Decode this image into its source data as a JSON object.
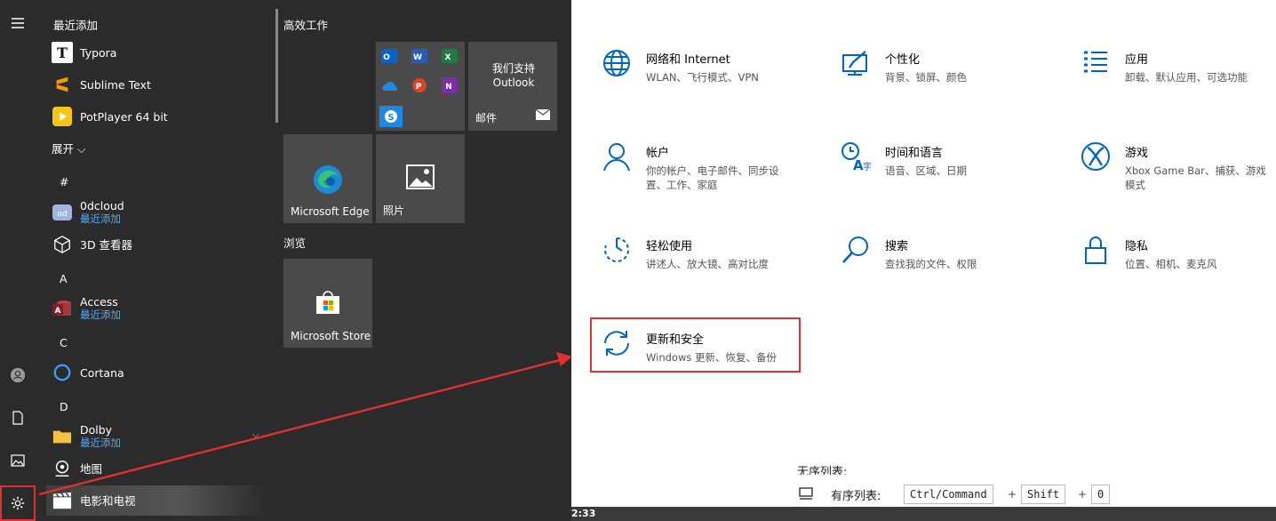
{
  "start_menu": {
    "recent_header": "最近添加",
    "expand_label": "展开",
    "apps": [
      {
        "name": "Typora",
        "sub": "",
        "icon": "typora-icon"
      },
      {
        "name": "Sublime Text",
        "sub": "",
        "icon": "sublime-icon"
      },
      {
        "name": "PotPlayer 64 bit",
        "sub": "",
        "icon": "potplayer-icon"
      },
      {
        "name": "0dcloud",
        "sub": "最近添加",
        "icon": "cloud-icon"
      },
      {
        "name": "3D 查看器",
        "sub": "",
        "icon": "3d-viewer-icon"
      },
      {
        "name": "Access",
        "sub": "最近添加",
        "icon": "access-icon"
      },
      {
        "name": "Cortana",
        "sub": "",
        "icon": "cortana-icon"
      },
      {
        "name": "Dolby",
        "sub": "最近添加",
        "icon": "folder-icon"
      },
      {
        "name": "地图",
        "sub": "",
        "icon": "maps-icon"
      },
      {
        "name": "电影和电视",
        "sub": "",
        "icon": "movies-icon"
      }
    ],
    "letters": [
      "#",
      "A",
      "C",
      "D"
    ],
    "tile_groups": {
      "productivity": "高效工作",
      "browse": "浏览"
    },
    "tiles": {
      "mail_promo": "我们支持 Outlook",
      "mail_label": "邮件",
      "edge_label": "Microsoft Edge",
      "photos_label": "照片",
      "store_label": "Microsoft Store"
    }
  },
  "settings": {
    "categories": [
      {
        "title": "网络和 Internet",
        "desc": "WLAN、飞行模式、VPN",
        "icon": "globe-icon"
      },
      {
        "title": "个性化",
        "desc": "背景、锁屏、颜色",
        "icon": "personalization-icon"
      },
      {
        "title": "应用",
        "desc": "卸载、默认应用、可选功能",
        "icon": "apps-icon"
      },
      {
        "title": "帐户",
        "desc": "你的帐户、电子邮件、同步设置、工作、家庭",
        "icon": "account-icon"
      },
      {
        "title": "时间和语言",
        "desc": "语音、区域、日期",
        "icon": "time-language-icon"
      },
      {
        "title": "游戏",
        "desc": "Xbox Game Bar、捕获、游戏模式",
        "icon": "xbox-icon"
      },
      {
        "title": "轻松使用",
        "desc": "讲述人、放大镜、高对比度",
        "icon": "ease-of-access-icon"
      },
      {
        "title": "搜索",
        "desc": "查找我的文件、权限",
        "icon": "search-icon"
      },
      {
        "title": "隐私",
        "desc": "位置、相机、麦克风",
        "icon": "lock-icon"
      },
      {
        "title": "更新和安全",
        "desc": "Windows 更新、恢复、备份",
        "icon": "update-icon"
      }
    ]
  },
  "behind_window": {
    "row_label": "有序列表:",
    "keys": [
      "Ctrl/Command",
      "Shift",
      "0"
    ],
    "partial_row_label": "无序列表:",
    "clock": "2:33"
  },
  "colors": {
    "accent": "#0067c0",
    "highlight": "#e03131"
  }
}
